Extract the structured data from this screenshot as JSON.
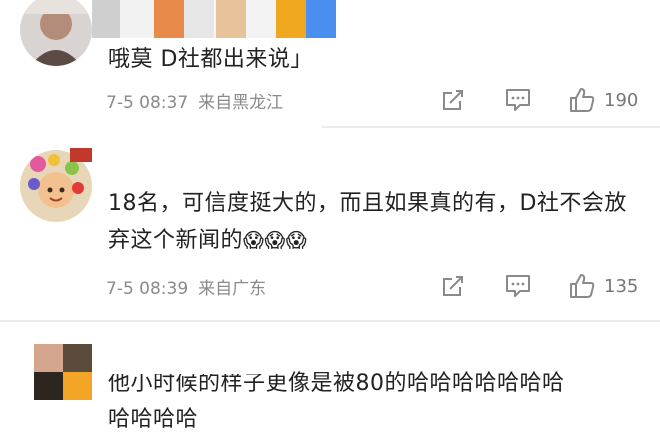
{
  "comments": [
    {
      "text": "哦莫 D社都出来说」",
      "time": "7-5 08:37",
      "location": "来自黑龙江",
      "likes": "190"
    },
    {
      "text": "18名，可信度挺大的，而且如果真的有，D社不会放弃这个新闻的",
      "emoji": "😱😱😱",
      "time": "7-5 08:39",
      "location": "来自广东",
      "likes": "135"
    },
    {
      "text_line1": "他小时候的样子更像是被80的哈哈哈哈哈哈哈",
      "text_line2": "哈哈哈哈"
    }
  ],
  "icons": [
    "share-icon",
    "comment-icon",
    "like-icon"
  ],
  "colors": {
    "text": "#222222",
    "meta": "#8a8a8a",
    "divider": "#ececec",
    "mosaic": [
      "#c7c7c7",
      "#e88a4a",
      "#e9e9e9",
      "#e8c29a",
      "#f2f2f2",
      "#f0a820",
      "#4a8ef0"
    ]
  }
}
